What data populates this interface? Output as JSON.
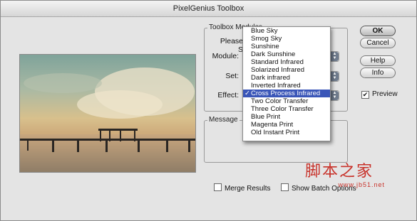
{
  "window": {
    "title": "PixelGenius Toolbox"
  },
  "toolbox": {
    "group_label": "Toolbox Modules",
    "prompt_label": "Please S",
    "module_label": "Module:",
    "set_label": "Set:",
    "effect_label": "Effect:"
  },
  "message": {
    "group_label": "Message"
  },
  "buttons": {
    "ok": "OK",
    "cancel": "Cancel",
    "help": "Help",
    "info": "Info"
  },
  "options": {
    "preview": "Preview",
    "preview_checked": true,
    "merge_results": "Merge Results",
    "merge_checked": false,
    "show_batch": "Show Batch Options",
    "show_batch_checked": false
  },
  "effect_menu": {
    "selected_index": 9,
    "items": [
      "Blue Sky",
      "Smog Sky",
      "Sunshine",
      "Dark Sunshine",
      "Standard Infrared",
      "Solarized Infrared",
      "Dark infrared",
      "Inverted Infrared",
      "Cross Process Infrared",
      "Two Color Transfer",
      "Three Color Transfer",
      "Blue Print",
      "Magenta Print",
      "Old  Instant Print"
    ],
    "checked_item": "Cross Process Infrared"
  },
  "watermark": {
    "text": "脚本之家",
    "url": "www.jb51.net"
  },
  "colors": {
    "highlight": "#3a56b8",
    "watermark": "#c8322a"
  }
}
